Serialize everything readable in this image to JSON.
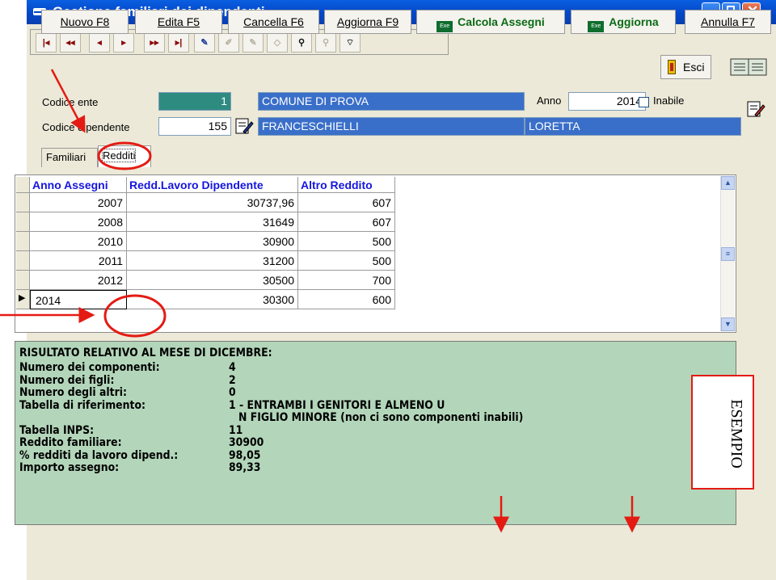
{
  "window": {
    "title": "Gestione familiari dei dipendenti",
    "app_icon": "app-icon"
  },
  "toolbar": {
    "nav_icons": [
      "first-record-icon",
      "prev-page-icon",
      "prev-record-icon",
      "next-record-icon",
      "next-page-icon",
      "last-record-icon",
      "new-record-icon",
      "edit-record-icon",
      "delete-record-icon",
      "cancel-edit-icon",
      "find-icon",
      "find-next-icon",
      "filter-icon"
    ],
    "exit_label": "Esci",
    "help_icon": "book-icon"
  },
  "header": {
    "codice_ente_label": "Codice ente",
    "codice_ente_value": "1",
    "ente_name": "COMUNE DI PROVA",
    "anno_label": "Anno",
    "anno_value": "2014",
    "inabile_label": "Inabile",
    "codice_dip_label": "Codice dipendente",
    "codice_dip_value": "155",
    "cognome": "FRANCESCHIELLI",
    "nome": "LORETTA"
  },
  "tabs": [
    {
      "label": "Familiari"
    },
    {
      "label": "Redditi"
    }
  ],
  "grid": {
    "columns": [
      "Anno Assegni",
      "Redd.Lavoro Dipendente",
      "Altro Reddito"
    ],
    "rows": [
      [
        "2007",
        "30737,96",
        "607"
      ],
      [
        "2008",
        "31649",
        "607"
      ],
      [
        "2010",
        "30900",
        "500"
      ],
      [
        "2011",
        "31200",
        "500"
      ],
      [
        "2012",
        "30500",
        "700"
      ],
      [
        "2014",
        "30300",
        "600"
      ]
    ]
  },
  "result": {
    "heading": "RISULTATO RELATIVO AL MESE DI DICEMBRE:",
    "lines": [
      {
        "label": "Numero dei componenti:",
        "value": "4"
      },
      {
        "label": "Numero dei figli:",
        "value": "2"
      },
      {
        "label": "Numero degli altri:",
        "value": "0"
      },
      {
        "label": "Tabella di riferimento:",
        "value": "1 - ENTRAMBI I GENITORI E ALMENO U"
      },
      {
        "label": "",
        "value": "N FIGLIO MINORE (non ci sono componenti inabili)"
      },
      {
        "label": "Tabella INPS:",
        "value": "11"
      },
      {
        "label": "Reddito familiare:",
        "value": "30900"
      },
      {
        "label": "% redditi da lavoro dipend.:",
        "value": "98,05"
      },
      {
        "label": "Importo assegno:",
        "value": "89,33"
      }
    ]
  },
  "annotation": {
    "stamp": "ESEMPIO",
    "color": "#E41B13"
  },
  "buttons": {
    "nuovo": "Nuovo F8",
    "edita": "Edita F5",
    "cancella": "Cancella F6",
    "aggiorna_f9": "Aggiorna F9",
    "calcola": "Calcola Assegni",
    "aggiorna": "Aggiorna",
    "annulla": "Annulla F7"
  }
}
